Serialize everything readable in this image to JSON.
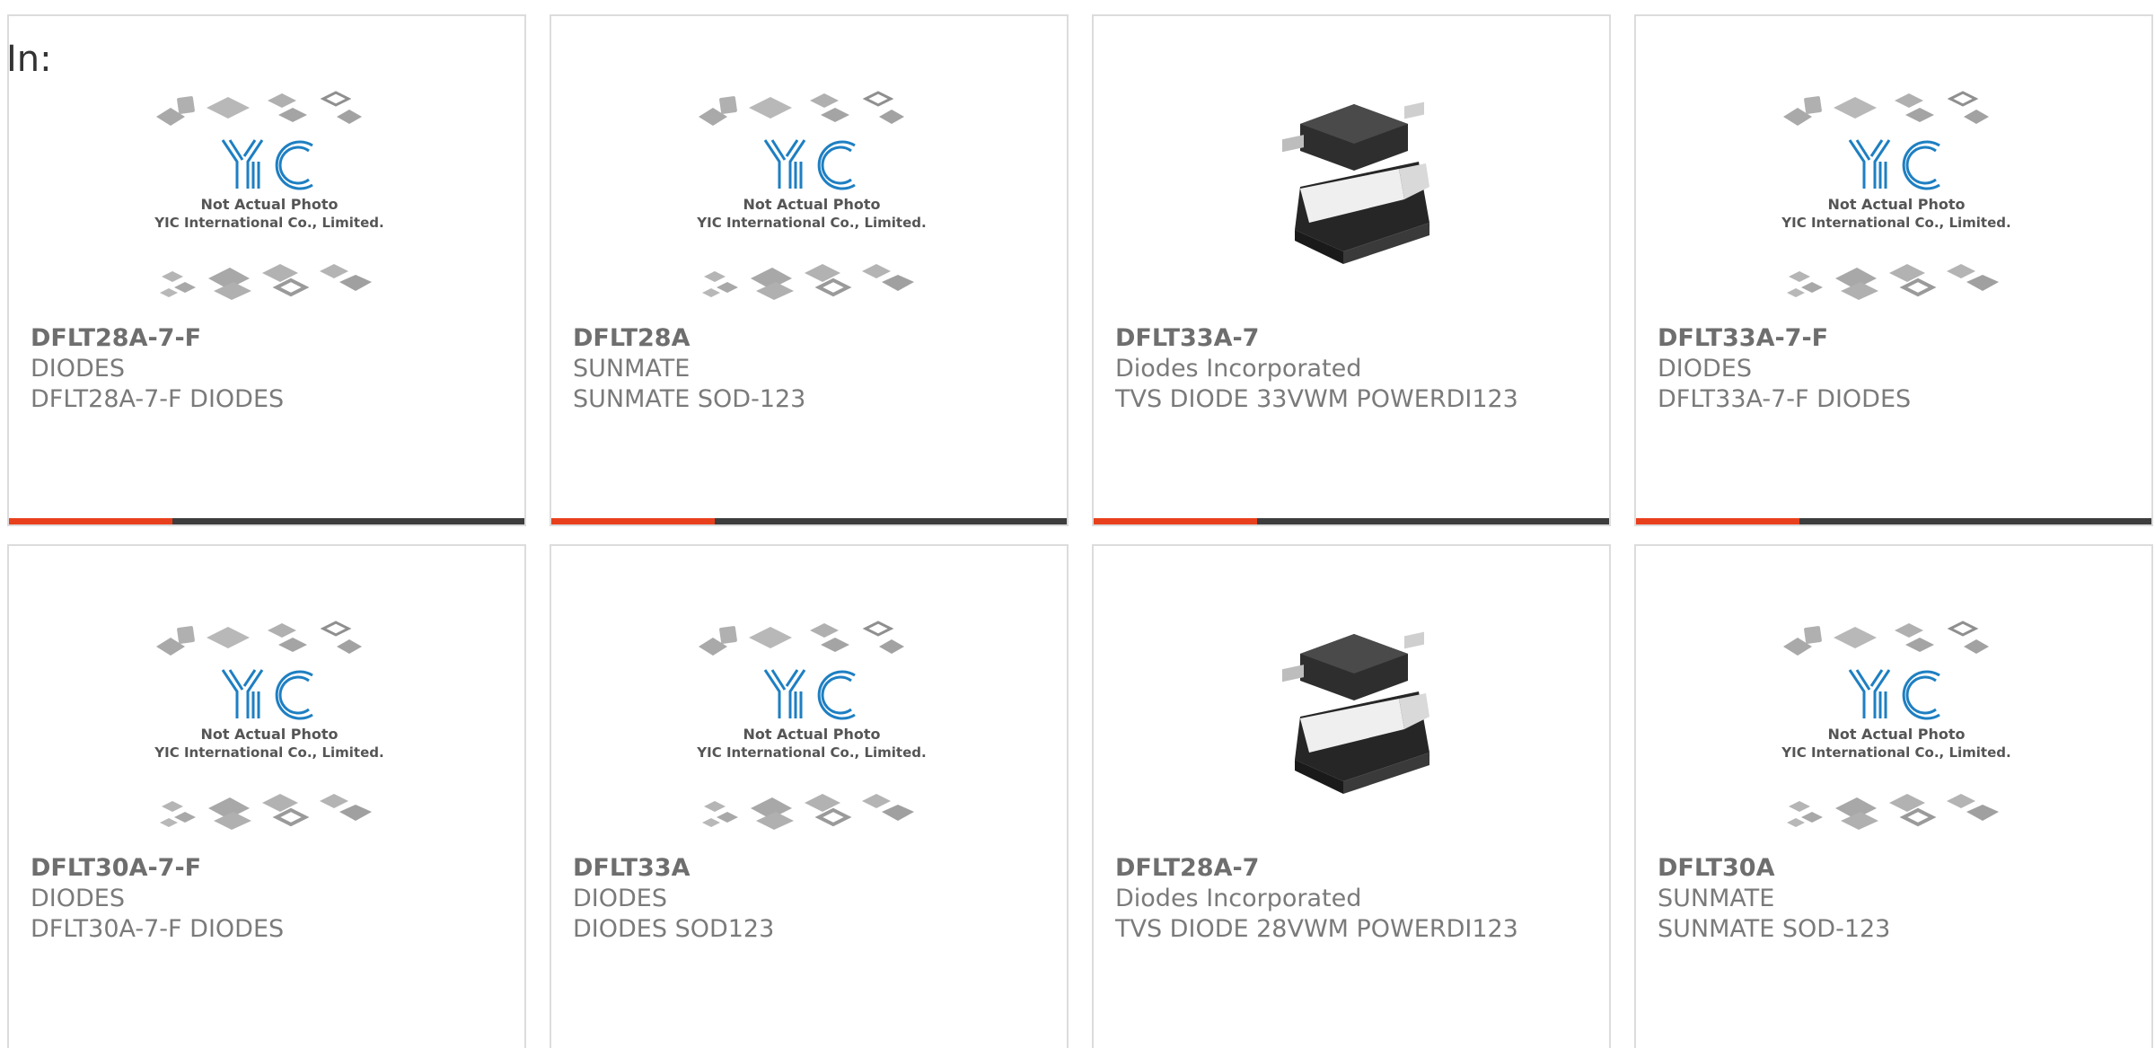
{
  "heading": "In:",
  "colors": {
    "accent": "#e8401c",
    "dark": "#3d3d3d",
    "card_border": "#dcdcdc",
    "text": "#6e6e6e"
  },
  "placeholder": {
    "title": "Not Actual Photo",
    "company": "YIC International Co., Limited.",
    "logo": "YIC"
  },
  "products": [
    {
      "part_number": "DFLT28A-7-F",
      "manufacturer": "DIODES",
      "description": "DFLT28A-7-F DIODES",
      "image": "placeholder"
    },
    {
      "part_number": "DFLT28A",
      "manufacturer": "SUNMATE",
      "description": "SUNMATE SOD-123",
      "image": "placeholder"
    },
    {
      "part_number": "DFLT33A-7",
      "manufacturer": "Diodes Incorporated",
      "description": "TVS DIODE 33VWM POWERDI123",
      "image": "powerdi123"
    },
    {
      "part_number": "DFLT33A-7-F",
      "manufacturer": "DIODES",
      "description": "DFLT33A-7-F DIODES",
      "image": "placeholder"
    },
    {
      "part_number": "DFLT30A-7-F",
      "manufacturer": "DIODES",
      "description": "DFLT30A-7-F DIODES",
      "image": "placeholder"
    },
    {
      "part_number": "DFLT33A",
      "manufacturer": "DIODES",
      "description": "DIODES SOD123",
      "image": "placeholder"
    },
    {
      "part_number": "DFLT28A-7",
      "manufacturer": "Diodes Incorporated",
      "description": "TVS DIODE 28VWM POWERDI123",
      "image": "powerdi123"
    },
    {
      "part_number": "DFLT30A",
      "manufacturer": "SUNMATE",
      "description": "SUNMATE SOD-123",
      "image": "placeholder"
    }
  ]
}
